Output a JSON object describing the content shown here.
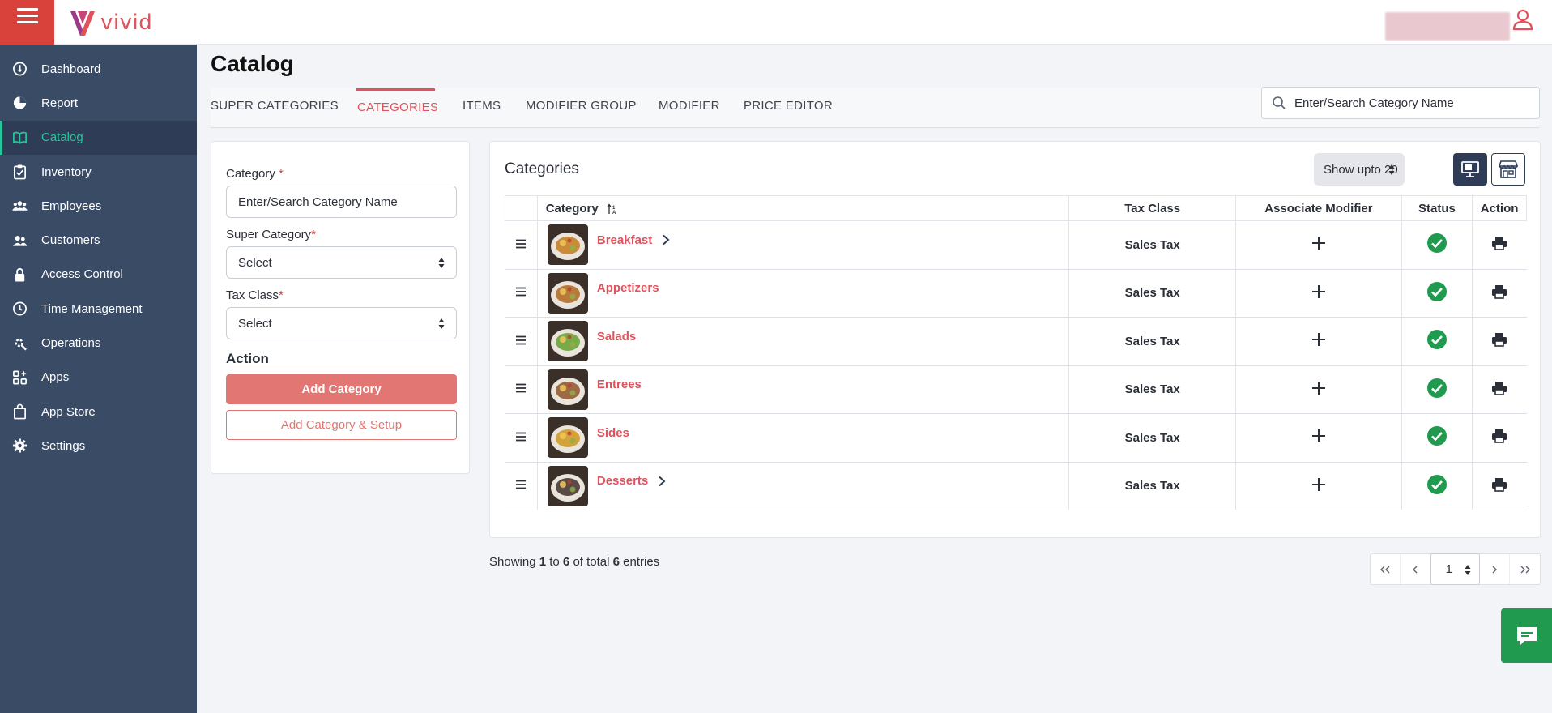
{
  "app": {
    "brand": "vivid",
    "accent": "#e0525c",
    "active_accent": "#26c69e"
  },
  "sidebar": {
    "items": [
      {
        "label": "Dashboard",
        "icon": "dashboard-icon"
      },
      {
        "label": "Report",
        "icon": "pie-chart-icon"
      },
      {
        "label": "Catalog",
        "icon": "book-icon",
        "active": true
      },
      {
        "label": "Inventory",
        "icon": "clipboard-icon"
      },
      {
        "label": "Employees",
        "icon": "group-icon"
      },
      {
        "label": "Customers",
        "icon": "customers-icon"
      },
      {
        "label": "Access Control",
        "icon": "lock-icon"
      },
      {
        "label": "Time Management",
        "icon": "clock-icon"
      },
      {
        "label": "Operations",
        "icon": "tools-icon"
      },
      {
        "label": "Apps",
        "icon": "apps-icon"
      },
      {
        "label": "App Store",
        "icon": "shopping-bag-icon"
      },
      {
        "label": "Settings",
        "icon": "gear-icon"
      }
    ]
  },
  "page": {
    "title": "Catalog"
  },
  "tabs": [
    {
      "label": "SUPER CATEGORIES"
    },
    {
      "label": "CATEGORIES",
      "active": true
    },
    {
      "label": "ITEMS"
    },
    {
      "label": "MODIFIER GROUP"
    },
    {
      "label": "MODIFIER"
    },
    {
      "label": "PRICE EDITOR"
    }
  ],
  "search": {
    "placeholder": "Enter/Search Category Name"
  },
  "form": {
    "category_label": "Category",
    "category_placeholder": "Enter/Search Category Name",
    "super_category_label": "Super Category",
    "super_category_value": "Select",
    "tax_class_label": "Tax Class",
    "tax_class_value": "Select",
    "required_mark": "*",
    "action_heading": "Action",
    "add_button": "Add Category",
    "add_setup_button": "Add Category & Setup"
  },
  "categories_panel": {
    "title": "Categories",
    "show_upto": "Show upto 20",
    "columns": [
      "Category",
      "Tax Class",
      "Associate Modifier",
      "Status",
      "Action"
    ],
    "rows": [
      {
        "name": "Breakfast",
        "tax": "Sales Tax",
        "has_children": true,
        "thumb": "#c98a3a"
      },
      {
        "name": "Appetizers",
        "tax": "Sales Tax",
        "has_children": false,
        "thumb": "#b77a3c"
      },
      {
        "name": "Salads",
        "tax": "Sales Tax",
        "has_children": false,
        "thumb": "#7aa94a"
      },
      {
        "name": "Entrees",
        "tax": "Sales Tax",
        "has_children": false,
        "thumb": "#9c6a45"
      },
      {
        "name": "Sides",
        "tax": "Sales Tax",
        "has_children": false,
        "thumb": "#d4a23b"
      },
      {
        "name": "Desserts",
        "tax": "Sales Tax",
        "has_children": true,
        "thumb": "#5a4a48"
      }
    ]
  },
  "footer": {
    "showing_prefix": "Showing",
    "from": "1",
    "to_word": "to",
    "to": "6",
    "of_total": "of total",
    "total": "6",
    "entries": "entries"
  },
  "pager": {
    "current": "1"
  }
}
